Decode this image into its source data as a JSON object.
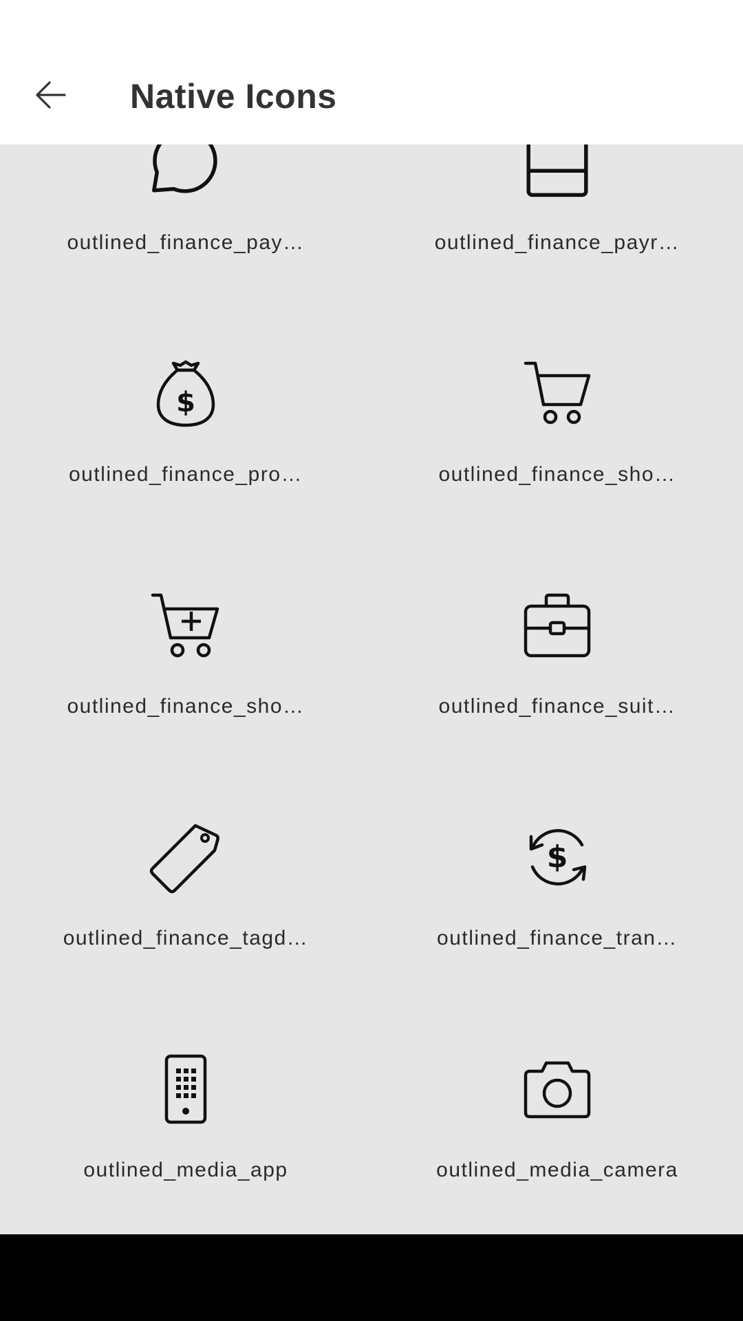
{
  "header": {
    "title": "Native Icons",
    "back_icon": "arrow-left-icon"
  },
  "icons": [
    {
      "label": "outlined_finance_pay…",
      "icon": "speech-bubble-dollar-icon"
    },
    {
      "label": "outlined_finance_payr…",
      "icon": "payroll-icon"
    },
    {
      "label": "outlined_finance_pro…",
      "icon": "money-bag-icon"
    },
    {
      "label": "outlined_finance_sho…",
      "icon": "shopping-cart-icon"
    },
    {
      "label": "outlined_finance_sho…",
      "icon": "cart-add-icon"
    },
    {
      "label": "outlined_finance_suit…",
      "icon": "suitcase-icon"
    },
    {
      "label": "outlined_finance_tagd…",
      "icon": "tag-icon"
    },
    {
      "label": "outlined_finance_tran…",
      "icon": "currency-exchange-icon"
    },
    {
      "label": "outlined_media_app",
      "icon": "remote-keypad-icon"
    },
    {
      "label": "outlined_media_camera",
      "icon": "camera-icon"
    }
  ],
  "colors": {
    "background": "#e6e6e6",
    "app_bar": "#ffffff",
    "text": "#2a2a2a",
    "icon_stroke": "#111111",
    "nav_bar": "#000000"
  }
}
